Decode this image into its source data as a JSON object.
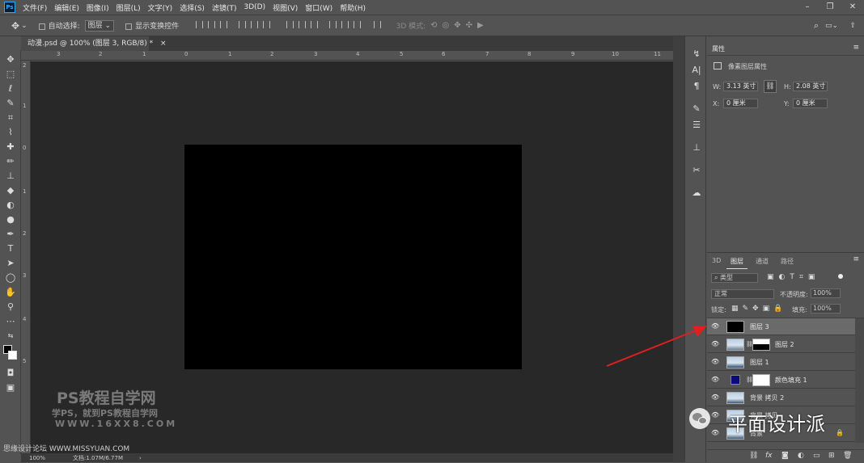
{
  "menubar": {
    "logo": "Ps",
    "items": [
      "文件(F)",
      "编辑(E)",
      "图像(I)",
      "图层(L)",
      "文字(Y)",
      "选择(S)",
      "滤镜(T)",
      "3D(D)",
      "视图(V)",
      "窗口(W)",
      "帮助(H)"
    ]
  },
  "options": {
    "auto_select": "自动选择:",
    "auto_select_value": "图层",
    "show_transform": "显示变换控件",
    "mode_3d": "3D 模式:"
  },
  "document": {
    "tab_title": "动漫.psd @ 100% (图层 3, RGB/8) *",
    "tab_close": "×"
  },
  "rulers": {
    "top": [
      "3",
      "2",
      "1",
      "0",
      "1",
      "2",
      "3",
      "4",
      "5",
      "6",
      "7",
      "8",
      "9",
      "10",
      "11"
    ],
    "left": [
      "2",
      "1",
      "0",
      "1",
      "2",
      "3",
      "4",
      "5"
    ]
  },
  "status": {
    "zoom": "100%",
    "doc": "文档:1.07M/6.77M"
  },
  "properties": {
    "tab": "属性",
    "kind": "像素图层属性",
    "w_label": "W:",
    "w_value": "3.13 英寸",
    "h_label": "H:",
    "h_value": "2.08 英寸",
    "x_label": "X:",
    "x_value": "0 厘米",
    "y_label": "Y:",
    "y_value": "0 厘米"
  },
  "layers_panel": {
    "tabs": [
      "3D",
      "图层",
      "通道",
      "路径"
    ],
    "filter": "类型",
    "blend": "正常",
    "opacity_label": "不透明度:",
    "opacity": "100%",
    "lock_label": "锁定:",
    "fill_label": "填充:",
    "fill": "100%",
    "layers": [
      {
        "name": "图层 3",
        "thumb": "black",
        "selected": true
      },
      {
        "name": "图层 2",
        "thumb": "landscape",
        "mask": true
      },
      {
        "name": "图层 1",
        "thumb": "landscape"
      },
      {
        "name": "颜色填充 1",
        "thumb": "navy",
        "mask": true
      },
      {
        "name": "背景 拷贝 2",
        "thumb": "landscape"
      },
      {
        "name": "背景 拷贝",
        "thumb": "landscape"
      },
      {
        "name": "背景",
        "thumb": "landscape",
        "locked": true
      }
    ]
  },
  "watermark": {
    "line1": "PS教程自学网",
    "line2": "学PS，就到PS教程自学网",
    "line3": "WWW.16XX8.COM",
    "bottom": "思缘设计论坛 WWW.MISSYUAN.COM",
    "wechat": "平面设计派"
  },
  "colors": {
    "canvas_bg": "#282828",
    "panel_bg": "#535353",
    "arrow": "#e02020",
    "artboard": "#000000"
  }
}
